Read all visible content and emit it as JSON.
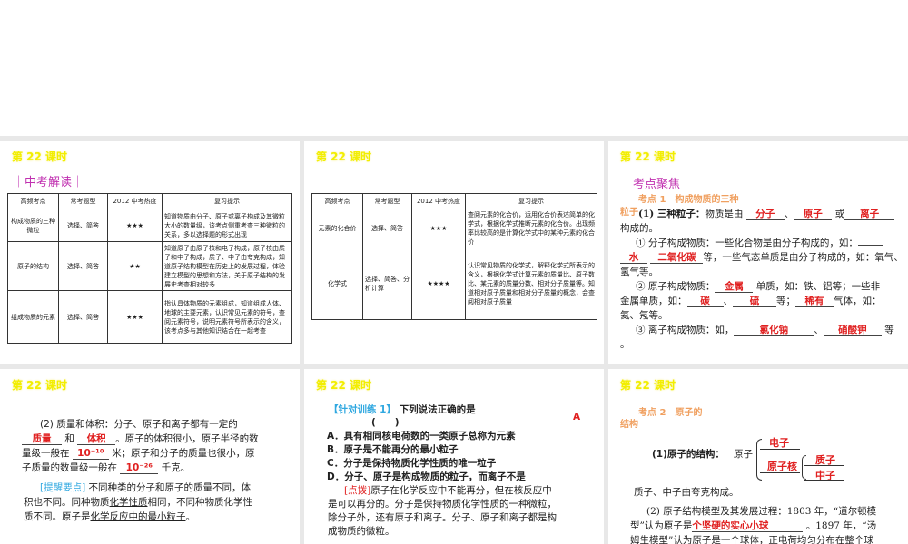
{
  "slide_title": "第 22 课时",
  "slide1": {
    "section": "｜中考解读｜",
    "headers": [
      "高频考点",
      "常考题型",
      "2012 中考热度",
      "复习提示"
    ],
    "rows": [
      [
        "构成物质的三种微粒",
        "选择、简答",
        "★★★",
        "知道物质由分子、原子或离子构成及其微粒大小的数量级，该考点侧重考查三种微粒的关系，多以选择题的形式出现"
      ],
      [
        "原子的结构",
        "选择、简答",
        "★★",
        "知道原子由原子核和电子构成，原子核由质子和中子构成，质子、中子由夸克构成，知道原子结构模型在历史上的发展过程，体验建立模型的思想和方法，关于原子结构的发展史考查相对较多"
      ],
      [
        "组成物质的元素",
        "选择、简答",
        "★★★",
        "指认具体物质的元素组成，知道组成人体、地球的主要元素，认识常见元素的符号，查阅元素符号，说明元素符号所表示的含义，该考点多与其他知识结合在一起考查"
      ]
    ]
  },
  "slide2": {
    "headers": [
      "高频考点",
      "常考题型",
      "2012 中考热度",
      "复习提示"
    ],
    "rows": [
      [
        "元素的化合价",
        "选择、简答",
        "★★★",
        "查阅元素的化合价，运用化合价表述简单的化学式，根据化学式推断元素的化合价。出现频率比较高的是计算化学式中的某种元素的化合价"
      ],
      [
        "化学式",
        "选择、简答、分析计算",
        "★★★★",
        "认识常见物质的化学式，解释化学式所表示的含义，根据化学式计算元素的质量比、原子数比、某元素的质量分数、相对分子质量等。知道相对原子质量和相对分子质量的概念，会查阅相对原子质量"
      ]
    ]
  },
  "slide3": {
    "section": "｜考点聚焦｜",
    "point": "考点 1　构成物质的三种",
    "point2": "粒子",
    "l1a": "(1) 三种粒子：",
    "l1b": "物质是由",
    "a1": "分子",
    "sep": "、",
    "a2": "原子",
    "or": "或",
    "a3": "离子",
    "l2": "构成的。",
    "l3": "① 分子构成物质：一些化合物是由分子构成的，如：",
    "a4": "水",
    "a5": "二氧化碳",
    "l4": "等，一些气态单质是由分子构成的，如：氧气、",
    "l5": "氢气等。",
    "l6a": "② 原子构成物质：",
    "a6": "金属",
    "l6b": "单质，如：铁、铝等；一些非",
    "l7a": "金属单质，如：",
    "a7": "碳",
    "a8": "硫",
    "l7b": "等；",
    "a9": "稀有",
    "l7c": "气体，如：",
    "l8": "氦、氖等。",
    "l9a": "③ 离子构成物质：如，",
    "a10": "氯化钠",
    "a11": "硝酸钾",
    "l9b": "等",
    "l10": "。"
  },
  "slide4": {
    "l1": "(2) 质量和体积：分子、原子和离子都有一定的",
    "a1": "质量",
    "and": "和",
    "a2": "体积",
    "l2": "。原子的体积很小，原子半径的数",
    "l3a": "量级一般在",
    "a3": "10⁻¹⁰",
    "l3b": "米；原子和分子的质量也很小，原",
    "l4a": "子质量的数量级一般在",
    "a4": "10⁻²⁶",
    "l4b": "千克。",
    "tip": "[提醒要点]",
    "l5": "不同种类的分子和原子的质量不同，体",
    "l6a": "积也不同。同种物质",
    "l6u": "化学性质",
    "l6b": "相同，不同种物质化学性",
    "l7a": "质不同。原子是",
    "l7u": "化学反应中的最小粒子",
    "l7b": "。"
  },
  "slide5": {
    "label": "【针对训练 1】",
    "question": "下列说法正确的是",
    "paren": "(　　)",
    "answer": "A",
    "options": [
      "A．具有相同核电荷数的一类原子总称为元素",
      "B．原子是不能再分的最小粒子",
      "C．分子是保持物质化学性质的唯一粒子",
      "D．分子、原子是构成物质的粒子，而离子不是"
    ],
    "hint_label": "[点拨]",
    "hint": [
      "原子在化学反应中不能再分，但在核反应中",
      "是可以再分的。分子是保持物质化学性质的一种微粒，",
      "除分子外，还有原子和离子。分子、原子和离子都是构",
      "成物质的微粒。"
    ]
  },
  "slide6": {
    "point": "考点 2　原子的",
    "point2": "结构",
    "struct_label": "(1)原子的结构：",
    "atom": "原子",
    "electron": "电子",
    "nucleus": "原子核",
    "proton": "质子",
    "neutron": "中子",
    "quark": "质子、中子由夸克构成。",
    "l1": "(2) 原子结构模型及其发展过程：1803 年，“道尔顿模",
    "l2a": "型”认为原子是",
    "a1": "个坚硬的实心小球",
    "l2b": "。1897 年，“汤",
    "l3": "姆生模型”认为原子是一个球体，正电荷均匀分布在整个球"
  }
}
